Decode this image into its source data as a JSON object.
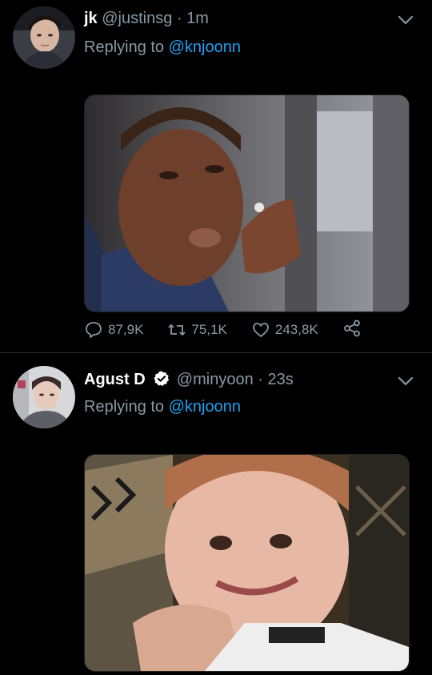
{
  "tweets": [
    {
      "name": "jk",
      "handle": "@justinsg",
      "separator": "·",
      "time": "1m",
      "verified": false,
      "replying_prefix": "Replying to",
      "replying_to": "@knjoonn",
      "replies": "87,9K",
      "retweets": "75,1K",
      "likes": "243,8K"
    },
    {
      "name": "Agust D",
      "handle": "@minyoon",
      "separator": "·",
      "time": "23s",
      "verified": true,
      "replying_prefix": "Replying to",
      "replying_to": "@knjoonn"
    }
  ],
  "colors": {
    "background": "#000000",
    "secondary_text": "#8899a6",
    "link": "#1da1f2",
    "name": "#ffffff"
  },
  "icons": [
    "chevron-down-icon",
    "reply-icon",
    "retweet-icon",
    "like-icon",
    "share-icon",
    "verified-badge-icon"
  ]
}
